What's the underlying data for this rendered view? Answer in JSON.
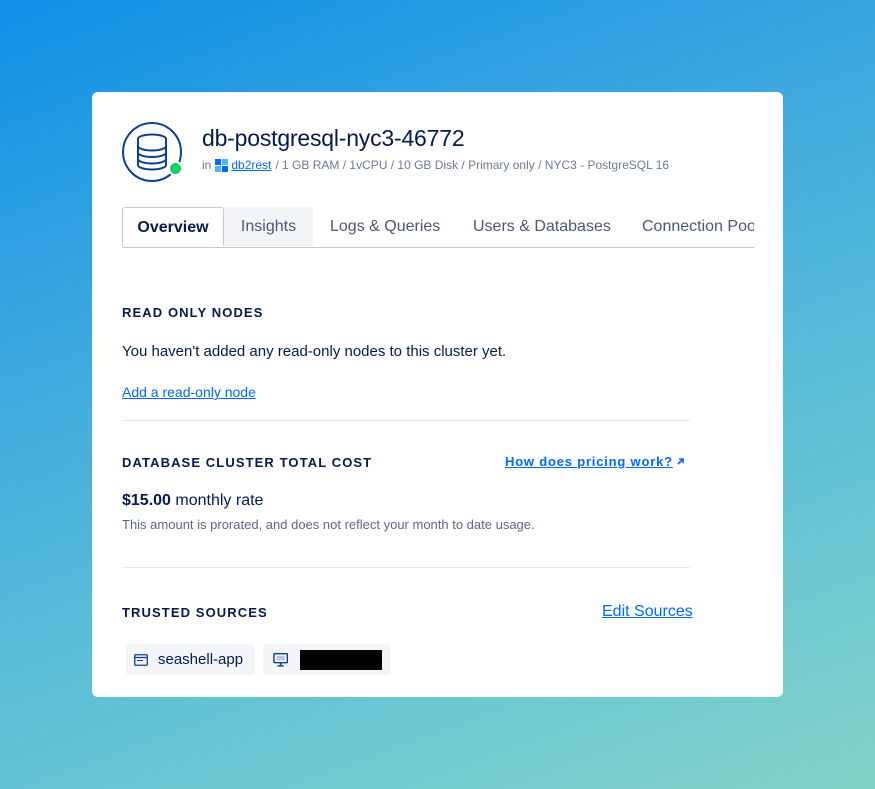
{
  "cluster": {
    "name": "db-postgresql-nyc3-46772",
    "status": "online",
    "meta_prefix": "in",
    "project": "db2rest",
    "specs": "/ 1 GB RAM / 1vCPU / 10 GB Disk / Primary only / NYC3 - PostgreSQL 16"
  },
  "tabs": [
    {
      "label": "Overview",
      "active": true
    },
    {
      "label": "Insights",
      "active": false
    },
    {
      "label": "Logs & Queries",
      "active": false
    },
    {
      "label": "Users & Databases",
      "active": false
    },
    {
      "label": "Connection Poo",
      "active": false
    }
  ],
  "read_only_nodes": {
    "heading": "READ ONLY NODES",
    "message": "You haven't added any read-only nodes to this cluster yet.",
    "add_link": "Add a read-only node"
  },
  "cost": {
    "heading": "DATABASE CLUSTER TOTAL COST",
    "pricing_link": "How does pricing work?",
    "amount": "$15.00",
    "rate_label": "monthly rate",
    "note": "This amount is prorated, and does not reflect your month to date usage."
  },
  "trusted_sources": {
    "heading": "TRUSTED SOURCES",
    "edit_link": "Edit Sources",
    "sources": [
      {
        "label": "seashell-app",
        "icon": "app-icon"
      },
      {
        "label": "",
        "icon": "droplet-monitor-icon",
        "redacted": true
      }
    ]
  },
  "colors": {
    "accent": "#0069ff",
    "text": "#031b4e",
    "status_online": "#15cd72"
  }
}
